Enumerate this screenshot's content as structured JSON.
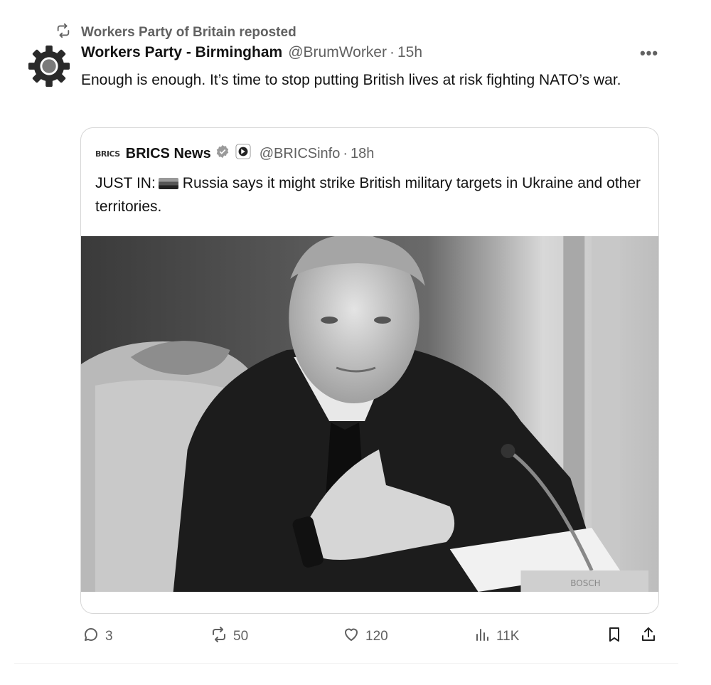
{
  "repost": {
    "text": "Workers Party of Britain reposted",
    "icon": "repost-icon"
  },
  "post": {
    "author_name": "Workers Party - Birmingham",
    "handle": "@BrumWorker",
    "separator": "·",
    "time": "15h",
    "text": "Enough is enough. It’s time to stop putting British lives at risk fighting NATO’s war.",
    "more_label": "•••",
    "avatar_icon": "gear-icon"
  },
  "quote": {
    "logo_text": "BRICS",
    "name": "BRICS News",
    "handle": "@BRICSinfo",
    "separator": "·",
    "time": "18h",
    "text_prefix": "JUST IN:",
    "text_body": "Russia says it might strike British military targets in Ukraine and other territories.",
    "flag_icon": "russia-flag-icon",
    "media_caption": "BOSCH"
  },
  "actions": {
    "replies": "3",
    "reposts": "50",
    "likes": "120",
    "views": "11K"
  },
  "colors": {
    "text": "#0f1419",
    "secondary": "#536471",
    "border": "#cfd9de"
  }
}
